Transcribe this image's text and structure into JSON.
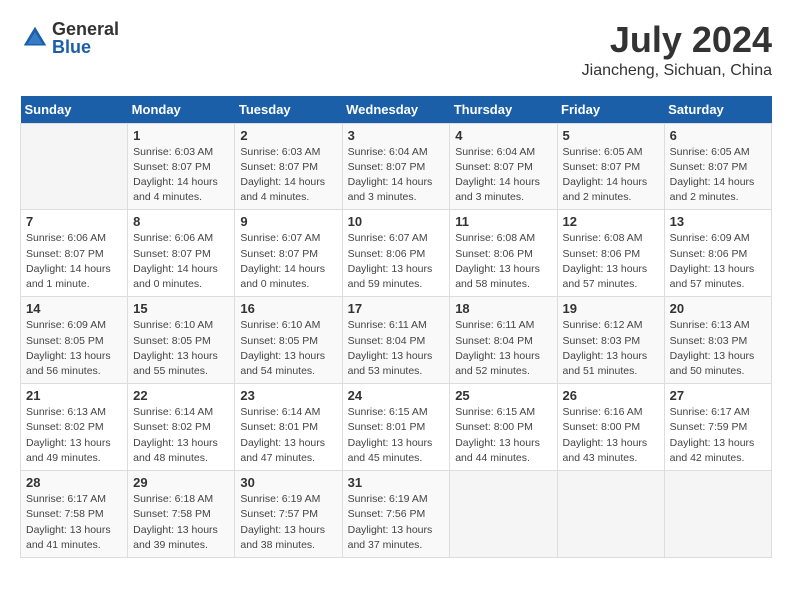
{
  "header": {
    "logo_general": "General",
    "logo_blue": "Blue",
    "month_year": "July 2024",
    "location": "Jiancheng, Sichuan, China"
  },
  "columns": [
    "Sunday",
    "Monday",
    "Tuesday",
    "Wednesday",
    "Thursday",
    "Friday",
    "Saturday"
  ],
  "weeks": [
    [
      {
        "day": "",
        "info": ""
      },
      {
        "day": "1",
        "info": "Sunrise: 6:03 AM\nSunset: 8:07 PM\nDaylight: 14 hours\nand 4 minutes."
      },
      {
        "day": "2",
        "info": "Sunrise: 6:03 AM\nSunset: 8:07 PM\nDaylight: 14 hours\nand 4 minutes."
      },
      {
        "day": "3",
        "info": "Sunrise: 6:04 AM\nSunset: 8:07 PM\nDaylight: 14 hours\nand 3 minutes."
      },
      {
        "day": "4",
        "info": "Sunrise: 6:04 AM\nSunset: 8:07 PM\nDaylight: 14 hours\nand 3 minutes."
      },
      {
        "day": "5",
        "info": "Sunrise: 6:05 AM\nSunset: 8:07 PM\nDaylight: 14 hours\nand 2 minutes."
      },
      {
        "day": "6",
        "info": "Sunrise: 6:05 AM\nSunset: 8:07 PM\nDaylight: 14 hours\nand 2 minutes."
      }
    ],
    [
      {
        "day": "7",
        "info": "Sunrise: 6:06 AM\nSunset: 8:07 PM\nDaylight: 14 hours\nand 1 minute."
      },
      {
        "day": "8",
        "info": "Sunrise: 6:06 AM\nSunset: 8:07 PM\nDaylight: 14 hours\nand 0 minutes."
      },
      {
        "day": "9",
        "info": "Sunrise: 6:07 AM\nSunset: 8:07 PM\nDaylight: 14 hours\nand 0 minutes."
      },
      {
        "day": "10",
        "info": "Sunrise: 6:07 AM\nSunset: 8:06 PM\nDaylight: 13 hours\nand 59 minutes."
      },
      {
        "day": "11",
        "info": "Sunrise: 6:08 AM\nSunset: 8:06 PM\nDaylight: 13 hours\nand 58 minutes."
      },
      {
        "day": "12",
        "info": "Sunrise: 6:08 AM\nSunset: 8:06 PM\nDaylight: 13 hours\nand 57 minutes."
      },
      {
        "day": "13",
        "info": "Sunrise: 6:09 AM\nSunset: 8:06 PM\nDaylight: 13 hours\nand 57 minutes."
      }
    ],
    [
      {
        "day": "14",
        "info": "Sunrise: 6:09 AM\nSunset: 8:05 PM\nDaylight: 13 hours\nand 56 minutes."
      },
      {
        "day": "15",
        "info": "Sunrise: 6:10 AM\nSunset: 8:05 PM\nDaylight: 13 hours\nand 55 minutes."
      },
      {
        "day": "16",
        "info": "Sunrise: 6:10 AM\nSunset: 8:05 PM\nDaylight: 13 hours\nand 54 minutes."
      },
      {
        "day": "17",
        "info": "Sunrise: 6:11 AM\nSunset: 8:04 PM\nDaylight: 13 hours\nand 53 minutes."
      },
      {
        "day": "18",
        "info": "Sunrise: 6:11 AM\nSunset: 8:04 PM\nDaylight: 13 hours\nand 52 minutes."
      },
      {
        "day": "19",
        "info": "Sunrise: 6:12 AM\nSunset: 8:03 PM\nDaylight: 13 hours\nand 51 minutes."
      },
      {
        "day": "20",
        "info": "Sunrise: 6:13 AM\nSunset: 8:03 PM\nDaylight: 13 hours\nand 50 minutes."
      }
    ],
    [
      {
        "day": "21",
        "info": "Sunrise: 6:13 AM\nSunset: 8:02 PM\nDaylight: 13 hours\nand 49 minutes."
      },
      {
        "day": "22",
        "info": "Sunrise: 6:14 AM\nSunset: 8:02 PM\nDaylight: 13 hours\nand 48 minutes."
      },
      {
        "day": "23",
        "info": "Sunrise: 6:14 AM\nSunset: 8:01 PM\nDaylight: 13 hours\nand 47 minutes."
      },
      {
        "day": "24",
        "info": "Sunrise: 6:15 AM\nSunset: 8:01 PM\nDaylight: 13 hours\nand 45 minutes."
      },
      {
        "day": "25",
        "info": "Sunrise: 6:15 AM\nSunset: 8:00 PM\nDaylight: 13 hours\nand 44 minutes."
      },
      {
        "day": "26",
        "info": "Sunrise: 6:16 AM\nSunset: 8:00 PM\nDaylight: 13 hours\nand 43 minutes."
      },
      {
        "day": "27",
        "info": "Sunrise: 6:17 AM\nSunset: 7:59 PM\nDaylight: 13 hours\nand 42 minutes."
      }
    ],
    [
      {
        "day": "28",
        "info": "Sunrise: 6:17 AM\nSunset: 7:58 PM\nDaylight: 13 hours\nand 41 minutes."
      },
      {
        "day": "29",
        "info": "Sunrise: 6:18 AM\nSunset: 7:58 PM\nDaylight: 13 hours\nand 39 minutes."
      },
      {
        "day": "30",
        "info": "Sunrise: 6:19 AM\nSunset: 7:57 PM\nDaylight: 13 hours\nand 38 minutes."
      },
      {
        "day": "31",
        "info": "Sunrise: 6:19 AM\nSunset: 7:56 PM\nDaylight: 13 hours\nand 37 minutes."
      },
      {
        "day": "",
        "info": ""
      },
      {
        "day": "",
        "info": ""
      },
      {
        "day": "",
        "info": ""
      }
    ]
  ]
}
